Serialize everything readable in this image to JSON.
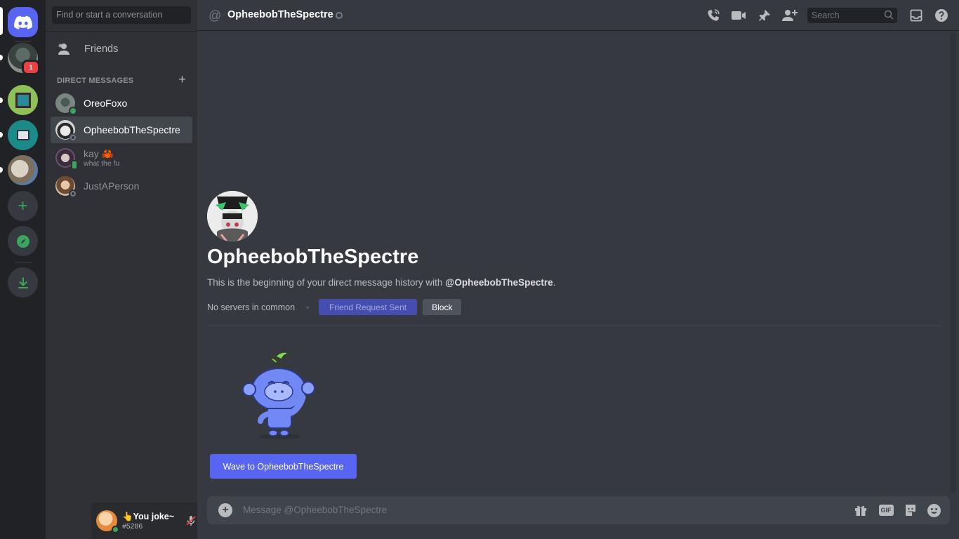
{
  "rail": {
    "home_label": "Home",
    "badge_count": "1",
    "add_server_label": "Add a Server",
    "explore_label": "Explore Public Servers",
    "download_label": "Download Apps"
  },
  "sidebar": {
    "search_placeholder": "Find or start a conversation",
    "friends_label": "Friends",
    "dm_header": "DIRECT MESSAGES",
    "dm_add": "+",
    "dms": [
      {
        "name": "OreoFoxo",
        "status": "online"
      },
      {
        "name": "OpheebobTheSpectre",
        "status": "offline"
      },
      {
        "name": "kay 🦀",
        "status": "mobile",
        "subtext": "what the fu"
      },
      {
        "name": "JustAPerson",
        "status": "offline"
      }
    ]
  },
  "user": {
    "name": "👆You joke~",
    "tag": "#5286"
  },
  "topbar": {
    "at": "@",
    "title": "OpheebobTheSpectre",
    "search_placeholder": "Search"
  },
  "intro": {
    "name": "OpheebobTheSpectre",
    "desc_prefix": "This is the beginning of your direct message history with ",
    "desc_handle": "@OpheebobTheSpectre",
    "desc_suffix": ".",
    "servers": "No servers in common",
    "friend_btn": "Friend Request Sent",
    "block_btn": "Block",
    "wave_btn": "Wave to OpheebobTheSpectre"
  },
  "composer": {
    "placeholder": "Message @OpheebobTheSpectre",
    "gif_label": "GIF"
  },
  "colors": {
    "blurple": "#5865f2",
    "online": "#3ba55d",
    "badge": "#ed4245"
  }
}
